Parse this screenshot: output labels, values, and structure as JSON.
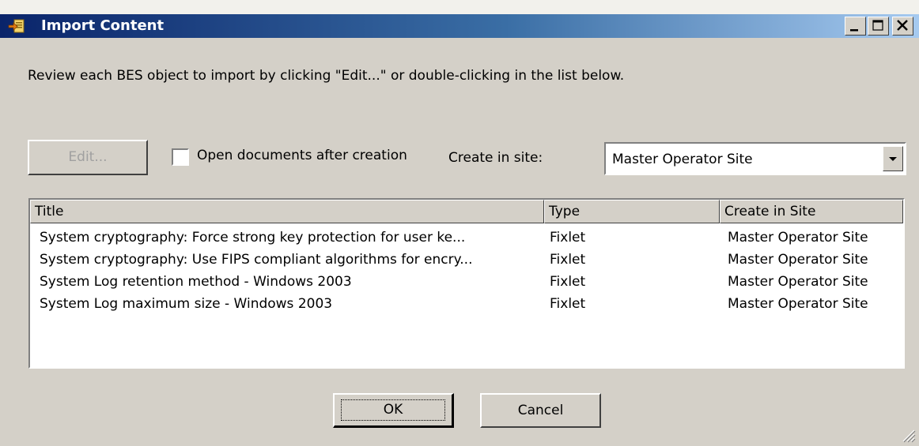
{
  "window": {
    "title": "Import Content",
    "icon": "import-content-icon"
  },
  "instruction": "Review each BES object to import by clicking \"Edit...\" or double-clicking in the list below.",
  "toolbar": {
    "edit_label": "Edit...",
    "open_documents_label": "Open documents after creation",
    "open_documents_checked": false,
    "create_in_site_label": "Create in site:",
    "create_in_site_value": "Master Operator Site"
  },
  "list": {
    "columns": [
      "Title",
      "Type",
      "Create in Site"
    ],
    "rows": [
      {
        "title": "System cryptography: Force strong key protection for user ke...",
        "type": "Fixlet",
        "site": "Master Operator Site"
      },
      {
        "title": "System cryptography: Use FIPS compliant algorithms for encry...",
        "type": "Fixlet",
        "site": "Master Operator Site"
      },
      {
        "title": "System Log retention method - Windows 2003",
        "type": "Fixlet",
        "site": "Master Operator Site"
      },
      {
        "title": "System Log maximum size - Windows 2003",
        "type": "Fixlet",
        "site": "Master Operator Site"
      }
    ]
  },
  "buttons": {
    "ok_label": "OK",
    "cancel_label": "Cancel"
  }
}
